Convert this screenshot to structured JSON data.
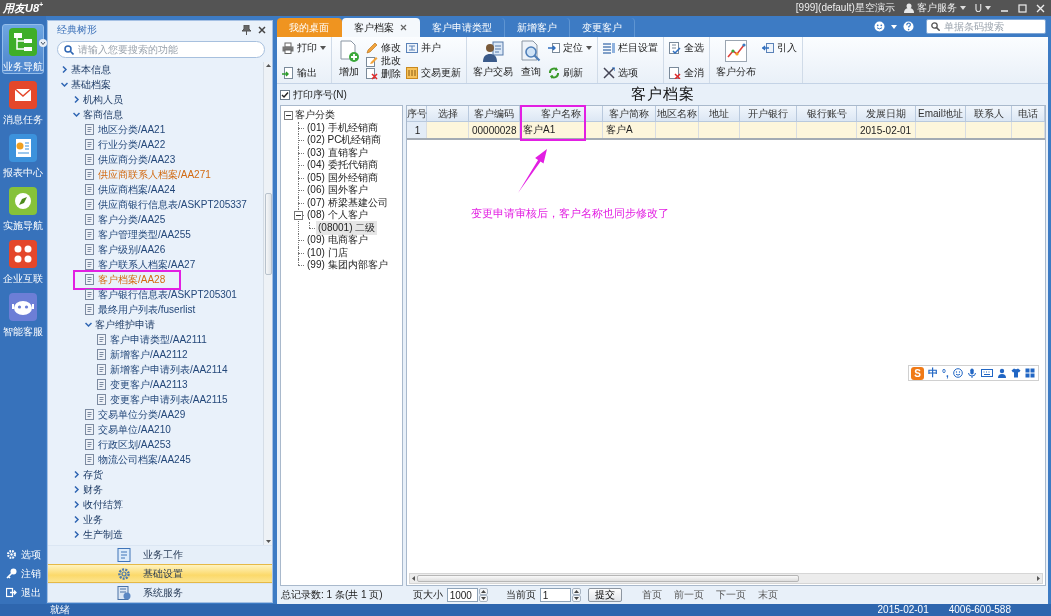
{
  "app": {
    "logo": "用友U8$^{+}$",
    "account": "[999](default)星空演示",
    "service": "客户服务",
    "user": "U"
  },
  "rail": {
    "items": [
      {
        "label": "业务导航",
        "selected": true
      },
      {
        "label": "消息任务",
        "selected": false
      },
      {
        "label": "报表中心",
        "selected": false
      },
      {
        "label": "实施导航",
        "selected": false
      },
      {
        "label": "企业互联",
        "selected": false
      },
      {
        "label": "智能客服",
        "selected": false
      }
    ],
    "actions": [
      {
        "label": "选项"
      },
      {
        "label": "注销"
      },
      {
        "label": "退出"
      }
    ]
  },
  "nav": {
    "title": "经典树形",
    "search": {
      "placeholder": "请输入您要搜索的功能"
    },
    "tree": [
      {
        "label": "基本信息",
        "kind": "folder",
        "expanded": false
      },
      {
        "label": "基础档案",
        "kind": "folder",
        "expanded": true,
        "children": [
          {
            "label": "机构人员",
            "kind": "folder",
            "expanded": false
          },
          {
            "label": "客商信息",
            "kind": "folder",
            "expanded": true,
            "children": [
              {
                "label": "地区分类/AA21",
                "kind": "page",
                "opened": false,
                "boxed": false
              },
              {
                "label": "行业分类/AA22",
                "kind": "page",
                "opened": false,
                "boxed": false
              },
              {
                "label": "供应商分类/AA23",
                "kind": "page",
                "opened": false,
                "boxed": false
              },
              {
                "label": "供应商联系人档案/AA271",
                "kind": "page",
                "opened": true,
                "boxed": false
              },
              {
                "label": "供应商档案/AA24",
                "kind": "page",
                "opened": false,
                "boxed": false
              },
              {
                "label": "供应商银行信息表/ASKPT205337",
                "kind": "page",
                "opened": false,
                "boxed": false
              },
              {
                "label": "客户分类/AA25",
                "kind": "page",
                "opened": false,
                "boxed": false
              },
              {
                "label": "客户管理类型/AA255",
                "kind": "page",
                "opened": false,
                "boxed": false
              },
              {
                "label": "客户级别/AA26",
                "kind": "page",
                "opened": false,
                "boxed": false
              },
              {
                "label": "客户联系人档案/AA27",
                "kind": "page",
                "opened": false,
                "boxed": false
              },
              {
                "label": "客户档案/AA28",
                "kind": "page",
                "opened": true,
                "boxed": true
              },
              {
                "label": "客户银行信息表/ASKPT205301",
                "kind": "page",
                "opened": false,
                "boxed": false
              },
              {
                "label": "最终用户列表/fuserlist",
                "kind": "page",
                "opened": false,
                "boxed": false
              },
              {
                "label": "客户维护申请",
                "kind": "folder",
                "expanded": true,
                "children": [
                  {
                    "label": "客户申请类型/AA2111",
                    "kind": "page",
                    "opened": false,
                    "boxed": false
                  },
                  {
                    "label": "新增客户/AA2112",
                    "kind": "page",
                    "opened": false,
                    "boxed": false
                  },
                  {
                    "label": "新增客户申请列表/AA2114",
                    "kind": "page",
                    "opened": false,
                    "boxed": false
                  },
                  {
                    "label": "变更客户/AA2113",
                    "kind": "page",
                    "opened": false,
                    "boxed": false
                  },
                  {
                    "label": "变更客户申请列表/AA2115",
                    "kind": "page",
                    "opened": false,
                    "boxed": false
                  }
                ]
              },
              {
                "label": "交易单位分类/AA29",
                "kind": "page",
                "opened": false,
                "boxed": false
              },
              {
                "label": "交易单位/AA210",
                "kind": "page",
                "opened": false,
                "boxed": false
              },
              {
                "label": "行政区划/AA253",
                "kind": "page",
                "opened": false,
                "boxed": false
              },
              {
                "label": "物流公司档案/AA245",
                "kind": "page",
                "opened": false,
                "boxed": false
              }
            ]
          },
          {
            "label": "存货",
            "kind": "folder",
            "expanded": false
          },
          {
            "label": "财务",
            "kind": "folder",
            "expanded": false
          },
          {
            "label": "收付结算",
            "kind": "folder",
            "expanded": false
          },
          {
            "label": "业务",
            "kind": "folder",
            "expanded": false
          },
          {
            "label": "生产制造",
            "kind": "folder",
            "expanded": false
          }
        ]
      }
    ],
    "modules": [
      {
        "label": "业务工作",
        "selected": false
      },
      {
        "label": "基础设置",
        "selected": true
      },
      {
        "label": "系统服务",
        "selected": false
      }
    ]
  },
  "tabs": [
    {
      "label": "我的桌面",
      "kind": "home",
      "selected": false,
      "closable": false
    },
    {
      "label": "客户档案",
      "kind": "page",
      "selected": true,
      "closable": true
    },
    {
      "label": "客户申请类型",
      "kind": "page",
      "selected": false,
      "closable": false
    },
    {
      "label": "新增客户",
      "kind": "page",
      "selected": false,
      "closable": false
    },
    {
      "label": "变更客户",
      "kind": "page",
      "selected": false,
      "closable": false
    }
  ],
  "search": {
    "placeholder": "单据条码搜索"
  },
  "toolbar": [
    {
      "columns": [
        {
          "kind": "stack",
          "buttons": [
            {
              "label": "打印",
              "dropdown": true
            },
            {
              "label": "输出",
              "dropdown": false
            }
          ]
        }
      ]
    },
    {
      "columns": [
        {
          "kind": "large",
          "buttons": [
            {
              "label": "增加",
              "dropdown": false
            }
          ]
        },
        {
          "kind": "stack",
          "buttons": [
            {
              "label": "修改",
              "dropdown": false
            },
            {
              "label": "批改",
              "dropdown": false
            },
            {
              "label": "删除",
              "dropdown": false
            }
          ]
        },
        {
          "kind": "stack",
          "buttons": [
            {
              "label": "并户",
              "dropdown": false
            },
            {
              "label": "交易更新",
              "dropdown": false
            }
          ]
        }
      ]
    },
    {
      "columns": [
        {
          "kind": "large",
          "buttons": [
            {
              "label": "客户交易",
              "dropdown": false
            }
          ]
        },
        {
          "kind": "large",
          "buttons": [
            {
              "label": "查询",
              "dropdown": false
            }
          ]
        },
        {
          "kind": "stack",
          "buttons": [
            {
              "label": "定位",
              "dropdown": true
            },
            {
              "label": "刷新",
              "dropdown": false
            }
          ]
        }
      ]
    },
    {
      "columns": [
        {
          "kind": "stack",
          "buttons": [
            {
              "label": "栏目设置",
              "dropdown": false
            },
            {
              "label": "选项",
              "dropdown": false
            }
          ]
        }
      ]
    },
    {
      "columns": [
        {
          "kind": "stack",
          "buttons": [
            {
              "label": "全选",
              "dropdown": false
            },
            {
              "label": "全消",
              "dropdown": false
            }
          ]
        }
      ]
    },
    {
      "columns": [
        {
          "kind": "large",
          "buttons": [
            {
              "label": "客户分布",
              "dropdown": false
            }
          ]
        },
        {
          "kind": "stack",
          "buttons": [
            {
              "label": "引入",
              "dropdown": false
            }
          ]
        }
      ]
    }
  ],
  "print_serial": {
    "label": "打印序号(N)",
    "checked": true
  },
  "title": "客户档案",
  "categories": [
    {
      "label": "客户分类",
      "expanded": true,
      "selected": false,
      "children": [
        {
          "label": "(01) 手机经销商",
          "selected": false
        },
        {
          "label": "(02) PC机经销商",
          "selected": false
        },
        {
          "label": "(03) 直销客户",
          "selected": false
        },
        {
          "label": "(04) 委托代销商",
          "selected": false
        },
        {
          "label": "(05) 国外经销商",
          "selected": false
        },
        {
          "label": "(06) 国外客户",
          "selected": false
        },
        {
          "label": "(07) 桥梁基建公司",
          "selected": false
        },
        {
          "label": "(08) 个人客户",
          "expanded": true,
          "selected": false,
          "children": [
            {
              "label": "(08001) 二级",
              "selected": true
            }
          ]
        },
        {
          "label": "(09) 电商客户",
          "selected": false
        },
        {
          "label": "(10) 门店",
          "selected": false
        },
        {
          "label": "(99) 集团内部客户",
          "selected": false
        }
      ]
    }
  ],
  "grid": {
    "columns": [
      {
        "label": "序号",
        "boxed": false
      },
      {
        "label": "选择",
        "boxed": false
      },
      {
        "label": "客户编码",
        "boxed": false
      },
      {
        "label": "客户名称",
        "boxed": true
      },
      {
        "label": "客户简称",
        "boxed": false
      },
      {
        "label": "地区名称",
        "boxed": false
      },
      {
        "label": "地址",
        "boxed": false
      },
      {
        "label": "开户银行",
        "boxed": false
      },
      {
        "label": "银行账号",
        "boxed": false
      },
      {
        "label": "发展日期",
        "boxed": false
      },
      {
        "label": "Email地址",
        "boxed": false
      },
      {
        "label": "联系人",
        "boxed": false
      },
      {
        "label": "电话",
        "boxed": false
      }
    ],
    "rows": [
      {
        "selected": true,
        "cells": [
          "1",
          null,
          "00000028",
          "客户A1",
          "客户A",
          null,
          null,
          null,
          null,
          "2015-02-01",
          null,
          null,
          null
        ]
      }
    ]
  },
  "annotation": {
    "text": "变更申请审核后，客户名称也同步修改了"
  },
  "pagination": {
    "total": "总记录数: 1 条(共 1 页)",
    "page_size_label": "页大小",
    "page_size": "1000",
    "page_label": "当前页",
    "page": "1",
    "submit": "提交",
    "links": [
      {
        "label": "首页",
        "disabled": true
      },
      {
        "label": "前一页",
        "disabled": true
      },
      {
        "label": "下一页",
        "disabled": true
      },
      {
        "label": "末页",
        "disabled": true
      }
    ]
  },
  "ime_bar": {
    "logo": "S",
    "mode": "中",
    "punctuation": "°,"
  },
  "status_bar": {
    "text": "就绪",
    "date": "2015-02-01",
    "phone": "4006-600-588"
  }
}
